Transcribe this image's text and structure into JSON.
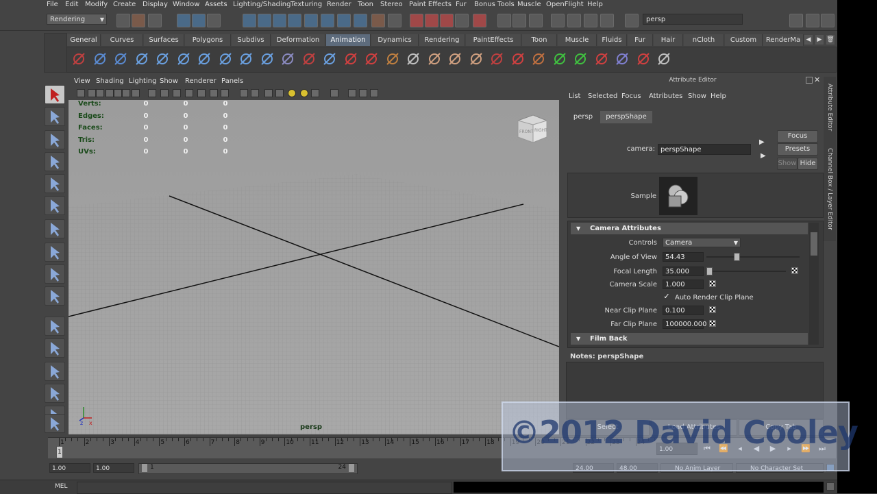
{
  "menubar": [
    "File",
    "Edit",
    "Modify",
    "Create",
    "Display",
    "Window",
    "Assets",
    "Lighting/Shading",
    "Texturing",
    "Render",
    "Toon",
    "Stereo",
    "Paint Effects",
    "Fur",
    "Bonus Tools",
    "Muscle",
    "OpenFlight",
    "Help"
  ],
  "statusline": {
    "mode": "Rendering",
    "camera_field": "persp"
  },
  "shelf": {
    "tabs": [
      "General",
      "Curves",
      "Surfaces",
      "Polygons",
      "Subdivs",
      "Deformation",
      "Animation",
      "Dynamics",
      "Rendering",
      "PaintEffects",
      "Toon",
      "Muscle",
      "Fluids",
      "Fur",
      "Hair",
      "nCloth",
      "Custom",
      "RenderMa"
    ],
    "active_tab": "Animation"
  },
  "viewport": {
    "menu": [
      "View",
      "Shading",
      "Lighting",
      "Show",
      "Renderer",
      "Panels"
    ],
    "hud": [
      {
        "label": "Verts:",
        "v1": "0",
        "v2": "0",
        "v3": "0"
      },
      {
        "label": "Edges:",
        "v1": "0",
        "v2": "0",
        "v3": "0"
      },
      {
        "label": "Faces:",
        "v1": "0",
        "v2": "0",
        "v3": "0"
      },
      {
        "label": "Tris:",
        "v1": "0",
        "v2": "0",
        "v3": "0"
      },
      {
        "label": "UVs:",
        "v1": "0",
        "v2": "0",
        "v3": "0"
      }
    ],
    "camera_label": "persp",
    "viewcube": {
      "front": "FRONT",
      "right": "RIGHT"
    }
  },
  "attribute_editor": {
    "title": "Attribute Editor",
    "menu": [
      "List",
      "Selected",
      "Focus",
      "Attributes",
      "Show",
      "Help"
    ],
    "tabs": [
      "persp",
      "perspShape"
    ],
    "active_tab": "perspShape",
    "camera_label": "camera:",
    "camera_value": "perspShape",
    "buttons": {
      "focus": "Focus",
      "presets": "Presets",
      "show": "Show",
      "hide": "Hide"
    },
    "sample_label": "Sample",
    "section_camera": "Camera Attributes",
    "controls_label": "Controls",
    "controls_value": "Camera",
    "angle_label": "Angle of View",
    "angle_value": "54.43",
    "focal_label": "Focal Length",
    "focal_value": "35.000",
    "scale_label": "Camera Scale",
    "scale_value": "1.000",
    "auto_clip_label": "Auto Render Clip Plane",
    "near_label": "Near Clip Plane",
    "near_value": "0.100",
    "far_label": "Far Clip Plane",
    "far_value": "100000.000",
    "section_film": "Film Back",
    "notes_label": "Notes:  perspShape",
    "bottom_buttons": [
      "Select",
      "Load Attributes",
      "Copy Tab"
    ]
  },
  "side_tabs": [
    "Attribute Editor",
    "Channel Box / Layer Editor"
  ],
  "timeline": {
    "ticks": [
      "1",
      "2",
      "3",
      "4",
      "5",
      "6",
      "7",
      "8",
      "9",
      "10",
      "11",
      "12",
      "13",
      "14",
      "15",
      "16",
      "17",
      "18",
      "19",
      "20",
      "21",
      "22",
      "23",
      "24"
    ],
    "current": "1",
    "current_time": "1.00"
  },
  "range": {
    "start": "1.00",
    "start2": "1.00",
    "inner_start": "1",
    "inner_end": "24",
    "end": "24.00",
    "end2": "48.00",
    "anim_layer": "No Anim Layer",
    "char_set": "No Character Set"
  },
  "cmdline": {
    "label": "MEL"
  },
  "watermark": "©2012 David Cooley"
}
